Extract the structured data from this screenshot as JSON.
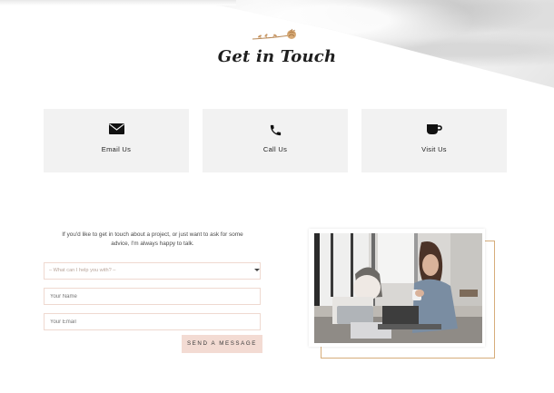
{
  "header": {
    "title": "Get in Touch",
    "ornament_icon": "dried-flower-sprig-icon"
  },
  "contact_cards": [
    {
      "label": "Email Us",
      "icon": "envelope-icon"
    },
    {
      "label": "Call Us",
      "icon": "phone-icon"
    },
    {
      "label": "Visit Us",
      "icon": "coffee-cup-icon"
    }
  ],
  "form": {
    "intro": "If you'd like to get in touch about a project, or just want to ask for some advice, I'm always happy to talk.",
    "topic_select": "– What can I help you with? –",
    "name_placeholder": "Your Name",
    "email_placeholder": "Your Email",
    "submit_label": "SEND A MESSAGE"
  },
  "colors": {
    "card_bg": "#f2f2f2",
    "field_border": "#efd9d0",
    "button_bg": "#f3dbd3",
    "frame_gold": "#d6ad7a"
  },
  "photo": {
    "subject": "woman-drinking-coffee-at-laptop-photo"
  }
}
